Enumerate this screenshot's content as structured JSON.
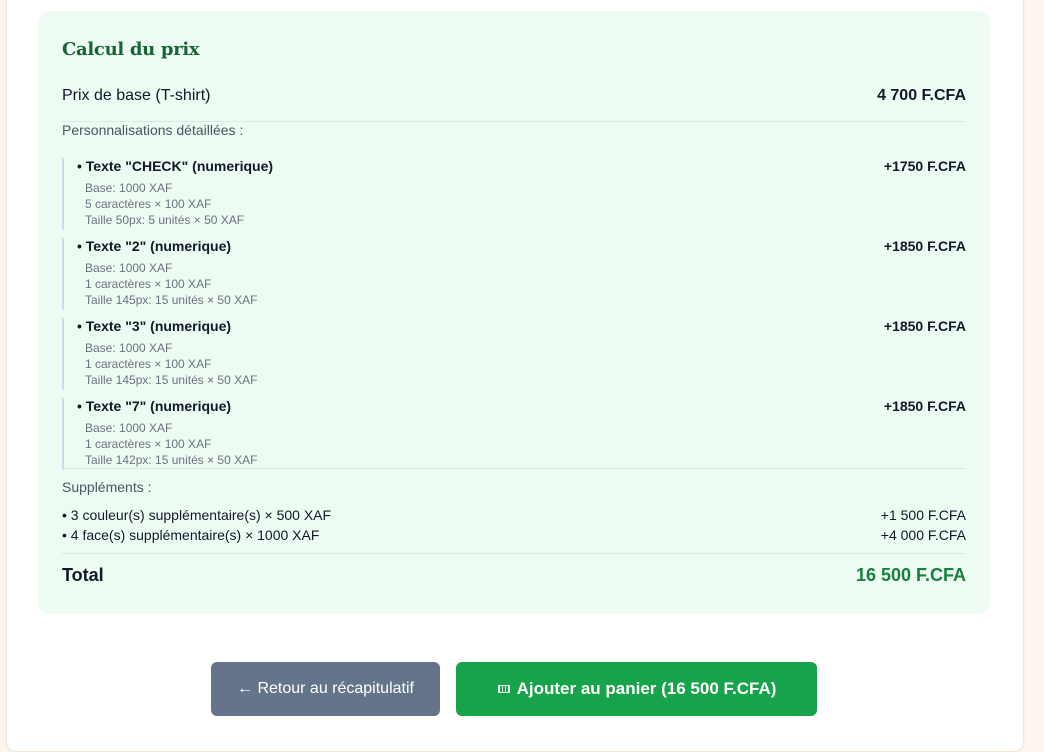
{
  "price": {
    "title": "Calcul du prix",
    "base_label": "Prix de base (T-shirt)",
    "base_amount": "4 700 F.CFA",
    "custom_label": "Personnalisations détaillées :",
    "customizations": [
      {
        "label": "• Texte \"CHECK\" (numerique)",
        "amount": "+1750 F.CFA",
        "details": [
          "Base: 1000 XAF",
          "5 caractères × 100 XAF",
          "Taille 50px: 5 unités × 50 XAF"
        ]
      },
      {
        "label": "• Texte \"2\" (numerique)",
        "amount": "+1850 F.CFA",
        "details": [
          "Base: 1000 XAF",
          "1 caractères × 100 XAF",
          "Taille 145px: 15 unités × 50 XAF"
        ]
      },
      {
        "label": "• Texte \"3\" (numerique)",
        "amount": "+1850 F.CFA",
        "details": [
          "Base: 1000 XAF",
          "1 caractères × 100 XAF",
          "Taille 145px: 15 unités × 50 XAF"
        ]
      },
      {
        "label": "• Texte \"7\" (numerique)",
        "amount": "+1850 F.CFA",
        "details": [
          "Base: 1000 XAF",
          "1 caractères × 100 XAF",
          "Taille 142px: 15 unités × 50 XAF"
        ]
      }
    ],
    "supplements_label": "Suppléments :",
    "supplements": [
      {
        "label": "• 3 couleur(s) supplémentaire(s) × 500 XAF",
        "amount": "+1 500 F.CFA"
      },
      {
        "label": "• 4 face(s) supplémentaire(s) × 1000 XAF",
        "amount": "+4 000 F.CFA"
      }
    ],
    "total_label": "Total",
    "total_amount": "16 500 F.CFA"
  },
  "buttons": {
    "back_label": "← Retour au récapitulatif",
    "add_label": "Ajouter au panier (16 500 F.CFA)",
    "add_icon": "shopping-cart-icon"
  },
  "colors": {
    "accent": "#16a34a",
    "total": "#15803d",
    "title": "#166534",
    "panel": "#eefbf3",
    "back_button": "#64748b"
  }
}
